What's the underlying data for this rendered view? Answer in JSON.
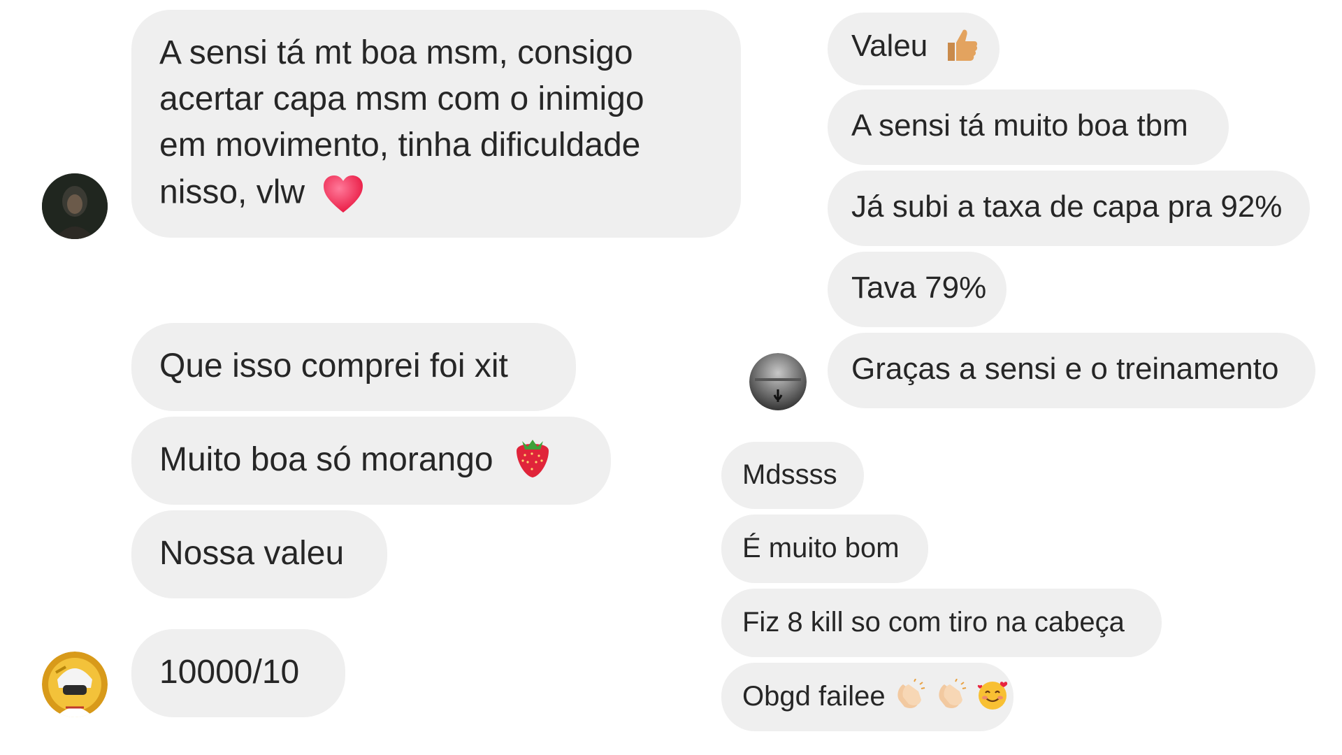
{
  "thread1": {
    "msg1": {
      "lines": [
        "A sensi tá mt boa msm, consigo",
        "acertar capa msm com o inimigo",
        "em movimento, tinha dificuldade",
        "nisso, vlw"
      ],
      "emoji": "red-heart"
    }
  },
  "thread2": {
    "messages": [
      {
        "text": "Que isso comprei foi xit"
      },
      {
        "text": "Muito boa só morango",
        "emoji": "strawberry"
      },
      {
        "text": "Nossa valeu"
      },
      {
        "text": "10000/10"
      }
    ]
  },
  "thread3": {
    "messages": [
      {
        "text": "Valeu",
        "emoji": "thumbs-up"
      },
      {
        "text": "A sensi tá muito boa tbm"
      },
      {
        "text": "Já subi a taxa de capa pra 92%"
      },
      {
        "text": "Tava 79%"
      },
      {
        "text": "Graças a sensi e o treinamento"
      }
    ]
  },
  "thread4": {
    "messages": [
      {
        "text": "Mdssss"
      },
      {
        "text": "É muito bom"
      },
      {
        "text": "Fiz 8 kill so com tiro na cabeça"
      },
      {
        "text": "Obgd failee",
        "emoji": [
          "clapping-hands",
          "clapping-hands",
          "smiling-face-with-hearts"
        ]
      }
    ]
  },
  "colors": {
    "bubble": "#efefef",
    "text": "#262626",
    "background": "#ffffff"
  }
}
